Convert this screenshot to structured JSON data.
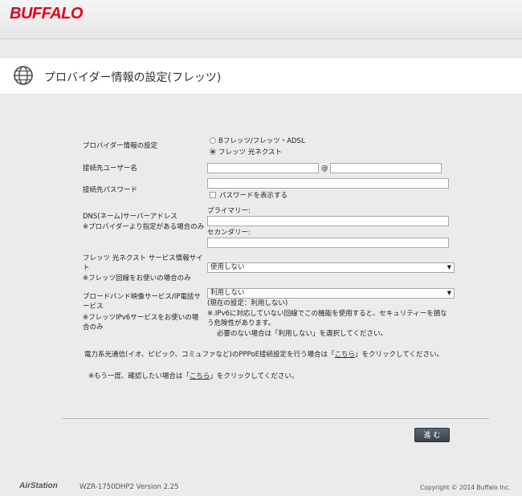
{
  "brand": "BUFFALO",
  "page_title": "プロバイダー情報の設定(フレッツ)",
  "form": {
    "provider": {
      "label": "プロバイダー情報の設定",
      "options": [
        "Bフレッツ/フレッツ・ADSL",
        "フレッツ 光ネクスト"
      ],
      "selected": "フレッツ 光ネクスト"
    },
    "username": {
      "label": "接続先ユーザー名",
      "value": "",
      "domain": "",
      "at": "@"
    },
    "password": {
      "label": "接続先パスワード",
      "value": "",
      "show_label": "パスワードを表示する"
    },
    "dns": {
      "label": "DNS(ネーム)サーバーアドレス",
      "note": "※プロバイダーより指定がある場合のみ",
      "primary_label": "プライマリー:",
      "secondary_label": "セカンダリー:",
      "primary": "",
      "secondary": ""
    },
    "info_site": {
      "label": "フレッツ 光ネクスト サービス情報サイト",
      "note": "※フレッツ回線をお使いの場合のみ",
      "value": "使用しない"
    },
    "broadband": {
      "label": "ブロードバンド映像サービス/IP電話サービス",
      "note": "※フレッツIPv6サービスをお使いの場合のみ",
      "value": "利用しない",
      "current": "(現在の設定：利用しない)",
      "warn1": "※.IPv6に対応していない回線でこの機能を使用すると、セキュリティーを損なう危険性があります。",
      "warn2": "必要のない場合は「利用しない」を選択してください。"
    }
  },
  "notes": {
    "line1_pre": "電力系光通信(イオ、ピピック、コミュファなど)のPPPoE接続設定を行う場合は「",
    "link": "こちら",
    "line1_post": "」をクリックしてください。",
    "line2_pre": "※もう一度、確認したい場合は「",
    "line2_post": "」をクリックしてください。"
  },
  "submit_label": "進 む",
  "footer": {
    "logo": "AirStation",
    "model": "WZR-1750DHP2   Version 2.25",
    "copyright": "Copyright © 2014 Buffalo Inc."
  }
}
